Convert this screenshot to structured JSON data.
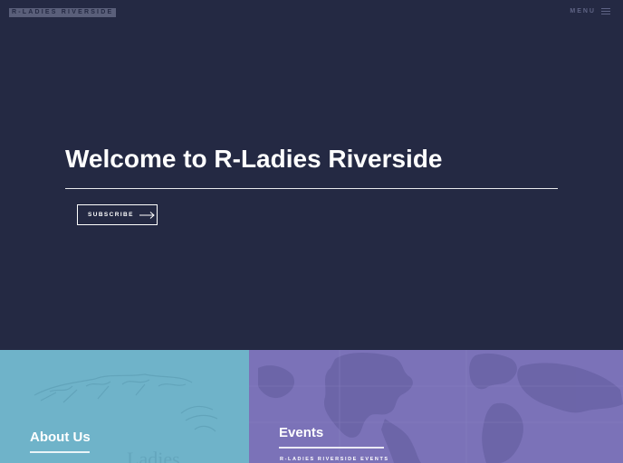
{
  "header": {
    "logo_text": "R-LADIES RIVERSIDE",
    "menu_label": "MENU"
  },
  "hero": {
    "title": "Welcome to R-Ladies Riverside",
    "subscribe_label": "SUBSCRIBE"
  },
  "tiles": [
    {
      "title": "About Us",
      "subtitle": ""
    },
    {
      "title": "Events",
      "subtitle": "R-LADIES RIVERSIDE EVENTS"
    }
  ],
  "colors": {
    "background": "#242943",
    "about_tile": "#6fb3c9",
    "events_tile": "#7b72b8",
    "text": "#ffffff"
  }
}
